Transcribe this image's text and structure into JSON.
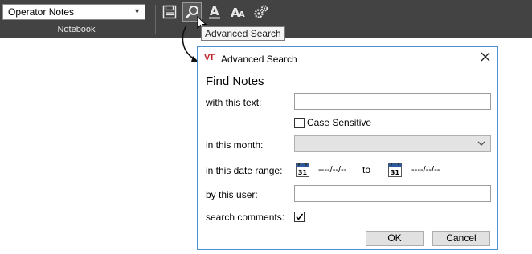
{
  "toolbar": {
    "notebook_select_value": "Operator Notes",
    "group_notebook_label": "Notebook",
    "group_tools_label_partial": "T",
    "icons": [
      "save-icon",
      "search-icon",
      "font-color-icon",
      "font-size-icon",
      "settings-gears-icon"
    ],
    "tooltip_text": "Advanced Search"
  },
  "dialog": {
    "title": "Advanced Search",
    "logo_text": "VT",
    "heading": "Find Notes",
    "with_text_label": "with this text:",
    "with_text_value": "",
    "case_sensitive_label": "Case Sensitive",
    "case_sensitive_checked": false,
    "month_label": "in this month:",
    "month_value": "",
    "date_range_label": "in this date range:",
    "date_from": "----/--/--",
    "date_to_label": "to",
    "date_to": "----/--/--",
    "calendar_day": "31",
    "user_label": "by this user:",
    "user_value": "",
    "comments_label": "search comments:",
    "comments_checked": true,
    "ok_label": "OK",
    "cancel_label": "Cancel"
  },
  "colors": {
    "ribbon_bg": "#434343",
    "dialog_border": "#4a90d9",
    "logo_red": "#c0282e",
    "calendar_blue": "#2b5aa0"
  }
}
